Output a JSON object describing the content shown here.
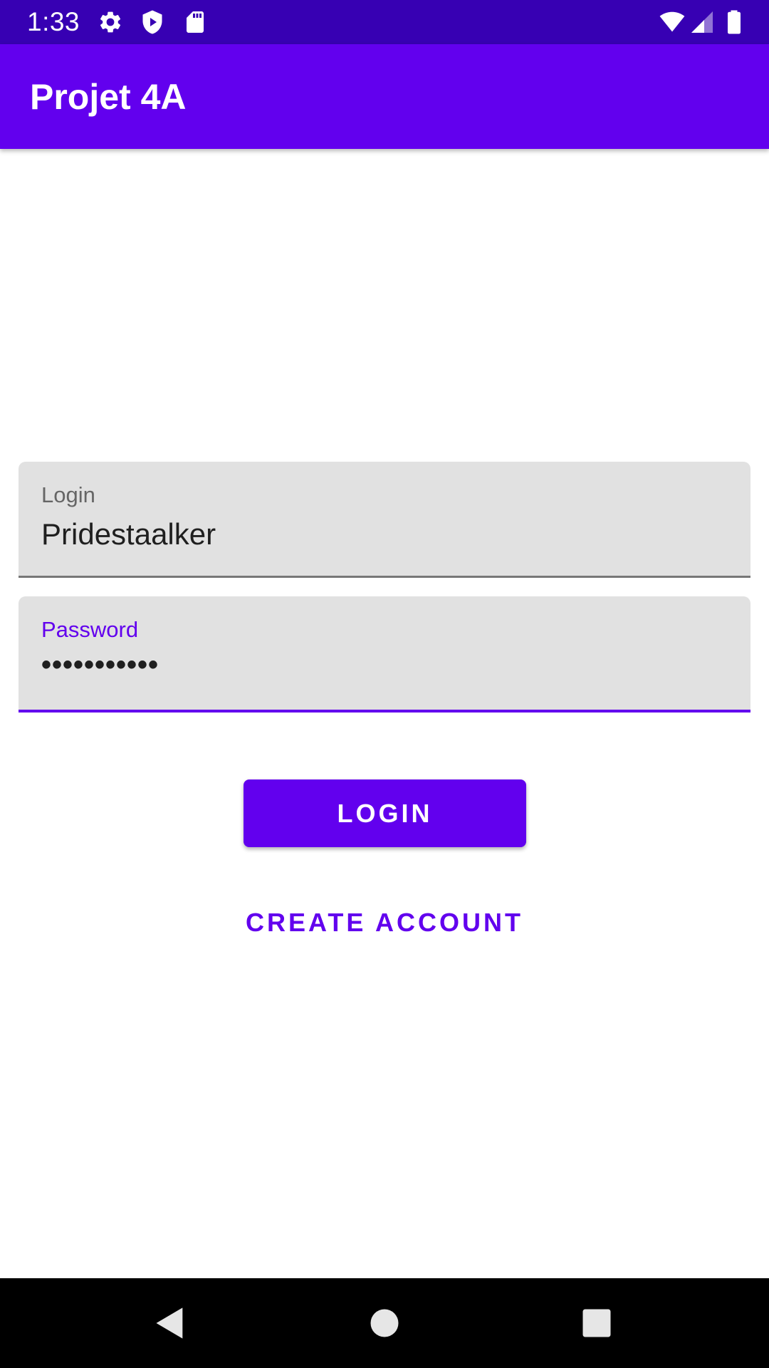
{
  "status_bar": {
    "time": "1:33",
    "icons": [
      "gear-icon",
      "shield-play-icon",
      "sd-card-icon",
      "wifi-icon",
      "cell-signal-icon",
      "battery-icon"
    ]
  },
  "app_bar": {
    "title": "Projet 4A"
  },
  "login_field": {
    "label": "Login",
    "value": "Pridestaalker"
  },
  "password_field": {
    "label": "Password",
    "value": "•••••••••••"
  },
  "buttons": {
    "login_label": "LOGIN",
    "create_account_label": "CREATE ACCOUNT"
  },
  "nav_bar": {
    "icons": [
      "back-icon",
      "home-icon",
      "recents-icon"
    ]
  },
  "colors": {
    "status_bar": "#3700b3",
    "primary": "#6200ee",
    "field_background": "#e1e1e1",
    "nav_bar": "#000000"
  }
}
